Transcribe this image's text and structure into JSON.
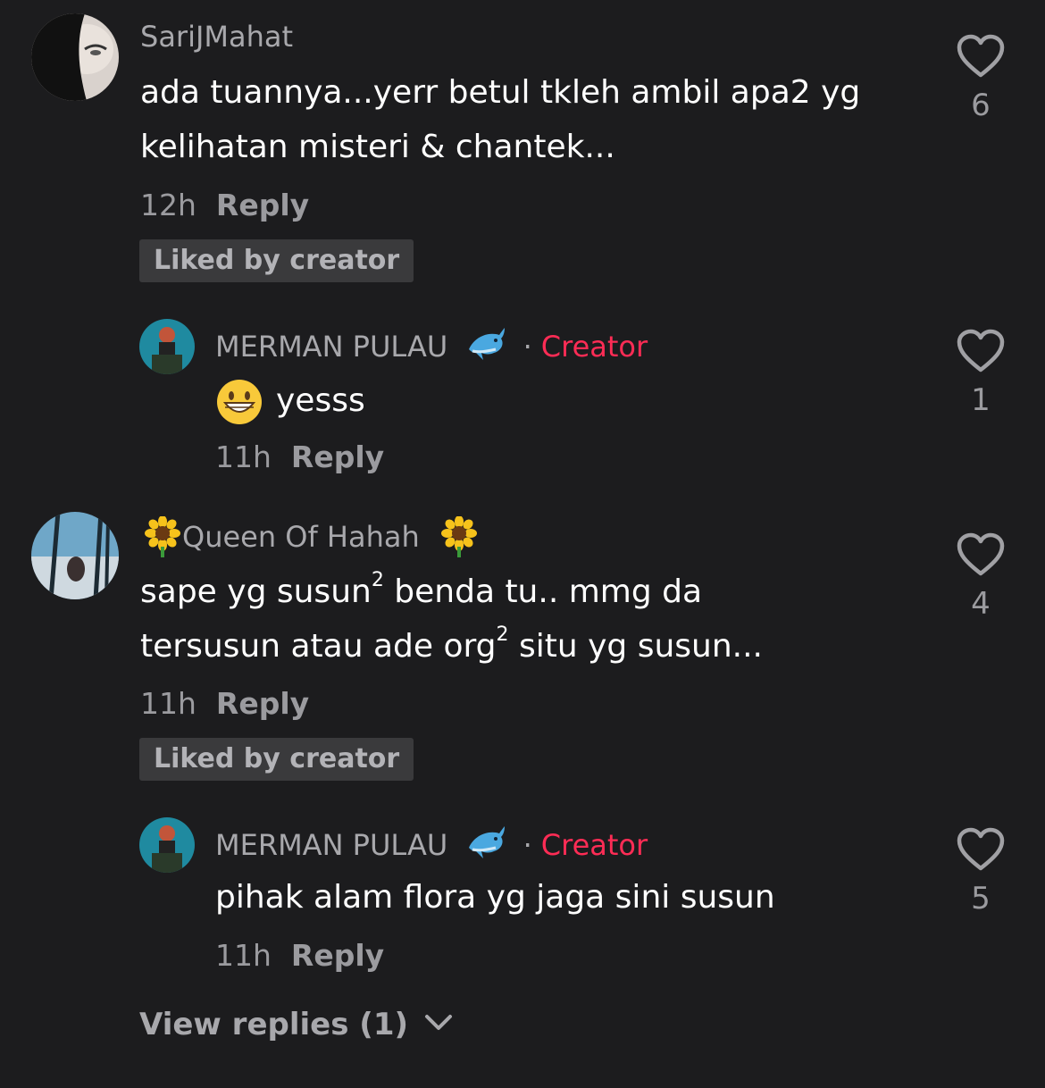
{
  "comments": [
    {
      "username": "SariJMahat",
      "lines": [
        "ada tuannya...yerr betul tkleh ambil apa2 yg",
        "kelihatan misteri & chantek..."
      ],
      "time": "12h",
      "reply_label": "Reply",
      "liked_label": "Liked by creator",
      "likes": "6",
      "reply": {
        "username": "MERMAN PULAU",
        "badge": "Creator",
        "text": "yesss",
        "time": "11h",
        "reply_label": "Reply",
        "likes": "1"
      }
    },
    {
      "username": "Queen Of Hahah",
      "line1_a": "sape yg susun",
      "line1_sup": "2",
      "line1_b": " benda tu.. mmg da",
      "line2_a": "tersusun atau ade org",
      "line2_sup": "2",
      "line2_b": " situ yg susun...",
      "time": "11h",
      "reply_label": "Reply",
      "liked_label": "Liked by creator",
      "likes": "4",
      "reply": {
        "username": "MERMAN PULAU",
        "badge": "Creator",
        "text": "pihak alam flora yg jaga sini susun",
        "time": "11h",
        "reply_label": "Reply",
        "likes": "5"
      }
    }
  ],
  "view_replies": "View replies (1)",
  "colors": {
    "background": "#1c1c1e",
    "creator": "#fe2c55",
    "muted": "#9b9b9f"
  },
  "icons": [
    "heart-outline-icon",
    "dolphin-emoji",
    "sunflower-emoji",
    "grinning-face-emoji",
    "chevron-down-icon"
  ]
}
